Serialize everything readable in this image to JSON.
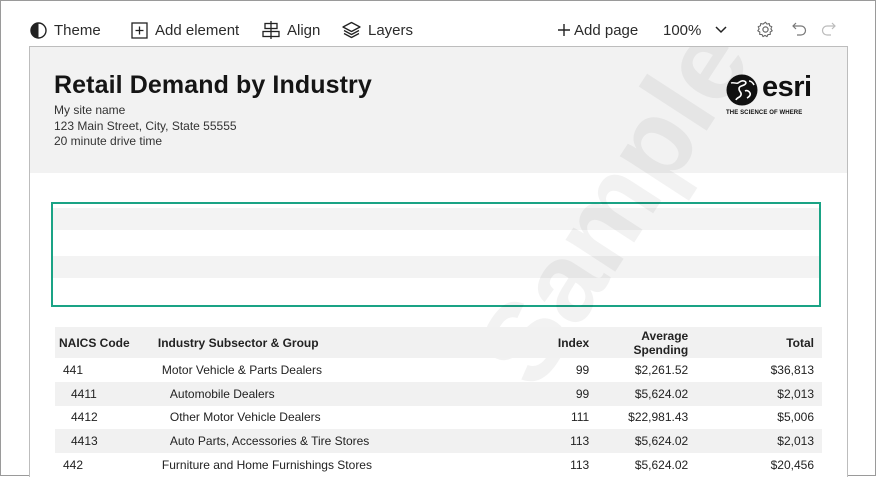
{
  "toolbar": {
    "theme_label": "Theme",
    "add_element_label": "Add element",
    "align_label": "Align",
    "layers_label": "Layers",
    "add_page_label": "Add page",
    "zoom": "100%"
  },
  "report": {
    "title": "Retail Demand by Industry",
    "site_name": "My site name",
    "address": "123 Main Street, City, State 55555",
    "drive_time": "20 minute drive time",
    "logo_word": "esri",
    "logo_tagline": "THE SCIENCE OF WHERE",
    "watermark": "Sample Data"
  },
  "table": {
    "headers": {
      "naics": "NAICS Code",
      "industry": "Industry Subsector & Group",
      "index": "Index",
      "avg_line1": "Average",
      "avg_line2": "Spending",
      "total": "Total"
    },
    "rows": [
      {
        "code": "441",
        "industry": "Motor Vehicle & Parts Dealers",
        "index": "99",
        "avg": "$2,261.52",
        "total": "$36,813",
        "level": 0
      },
      {
        "code": "4411",
        "industry": "Automobile Dealers",
        "index": "99",
        "avg": "$5,624.02",
        "total": "$2,013",
        "level": 1
      },
      {
        "code": "4412",
        "industry": "Other Motor Vehicle Dealers",
        "index": "111",
        "avg": "$22,981.43",
        "total": "$5,006",
        "level": 1
      },
      {
        "code": "4413",
        "industry": "Auto Parts, Accessories & Tire Stores",
        "index": "113",
        "avg": "$5,624.02",
        "total": "$2,013",
        "level": 1
      },
      {
        "code": "442",
        "industry": "Furniture and Home Furnishings Stores",
        "index": "113",
        "avg": "$5,624.02",
        "total": "$20,456",
        "level": 0
      }
    ]
  },
  "colors": {
    "accent": "#1aa385",
    "header_bg": "#f2f2f2"
  }
}
